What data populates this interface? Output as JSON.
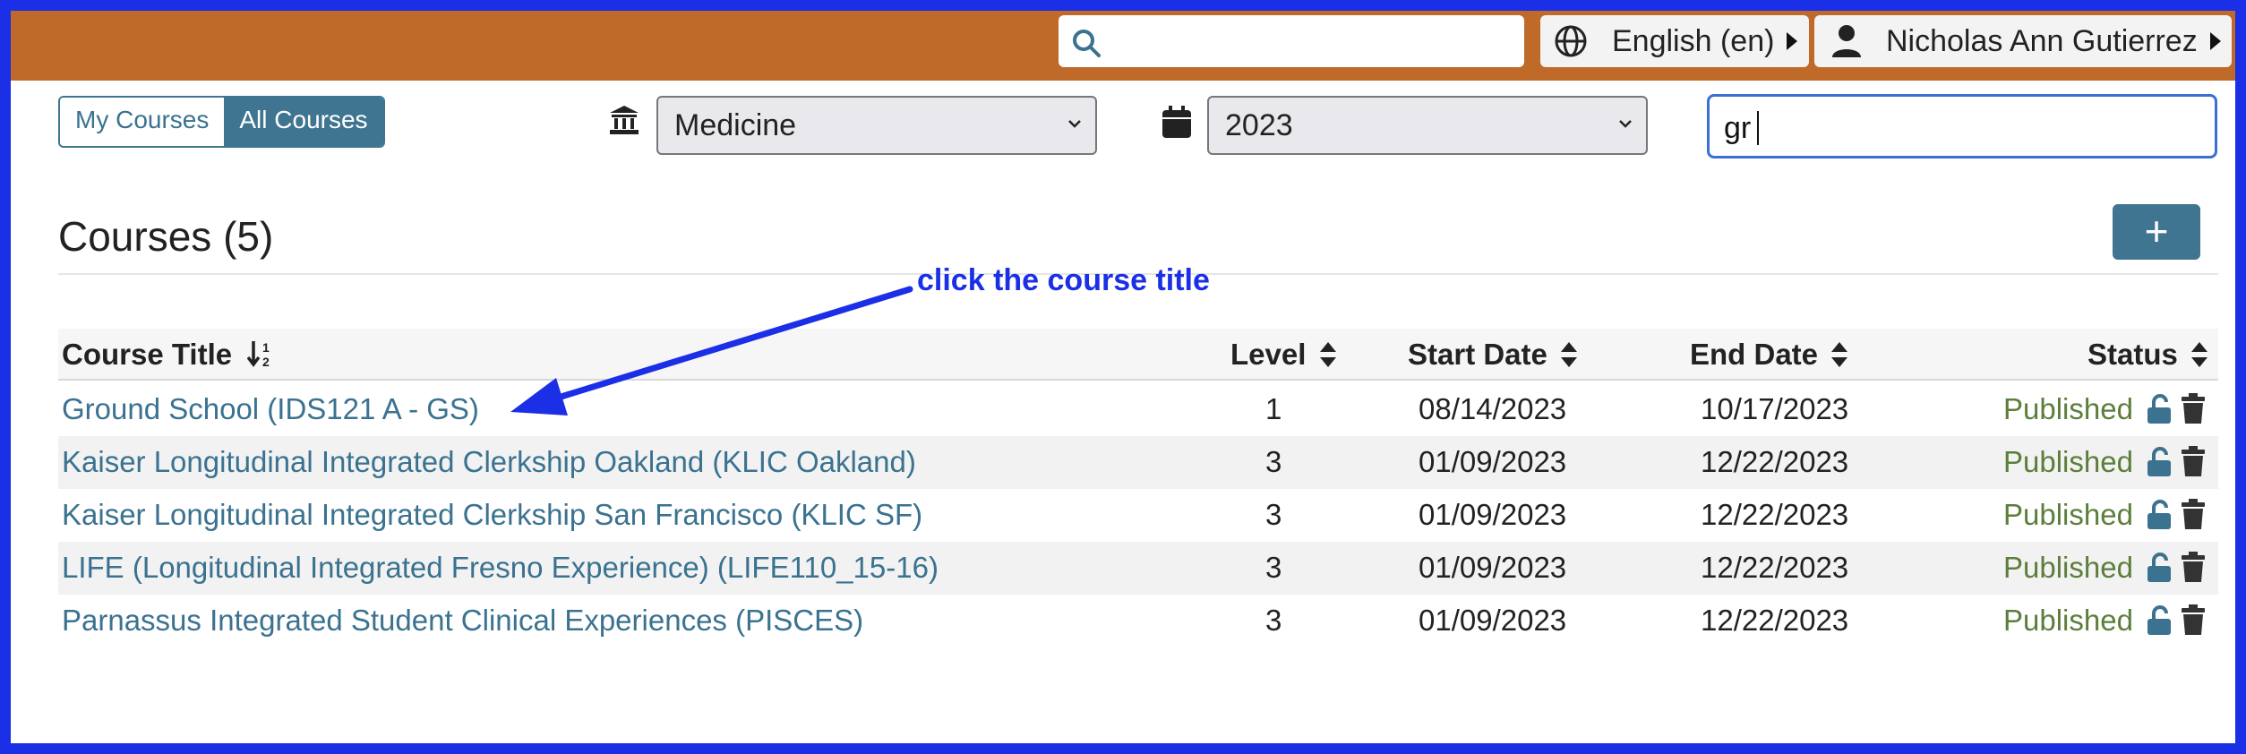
{
  "topbar": {
    "search_placeholder": "",
    "language_label": "English (en)",
    "user_name": "Nicholas Ann Gutierrez"
  },
  "toggle": {
    "my_courses": "My Courses",
    "all_courses": "All Courses"
  },
  "filters": {
    "school": "Medicine",
    "year": "2023",
    "search_value": "gr"
  },
  "heading": "Courses (5)",
  "add_button": "+",
  "annotation": "click the course title",
  "table": {
    "headers": {
      "title": "Course Title",
      "level": "Level",
      "start": "Start Date",
      "end": "End Date",
      "status": "Status"
    },
    "rows": [
      {
        "title": "Ground School (IDS121 A - GS)",
        "level": "1",
        "start": "08/14/2023",
        "end": "10/17/2023",
        "status": "Published"
      },
      {
        "title": "Kaiser Longitudinal Integrated Clerkship Oakland (KLIC Oakland)",
        "level": "3",
        "start": "01/09/2023",
        "end": "12/22/2023",
        "status": "Published"
      },
      {
        "title": "Kaiser Longitudinal Integrated Clerkship San Francisco (KLIC SF)",
        "level": "3",
        "start": "01/09/2023",
        "end": "12/22/2023",
        "status": "Published"
      },
      {
        "title": "LIFE (Longitudinal Integrated Fresno Experience) (LIFE110_15-16)",
        "level": "3",
        "start": "01/09/2023",
        "end": "12/22/2023",
        "status": "Published"
      },
      {
        "title": "Parnassus Integrated Student Clinical Experiences (PISCES)",
        "level": "3",
        "start": "01/09/2023",
        "end": "12/22/2023",
        "status": "Published"
      }
    ]
  },
  "colors": {
    "topbar": "#bf6a28",
    "accent": "#3f7590",
    "link": "#3a7290",
    "status": "#5c7e3b",
    "annotation": "#1a2fe6"
  }
}
